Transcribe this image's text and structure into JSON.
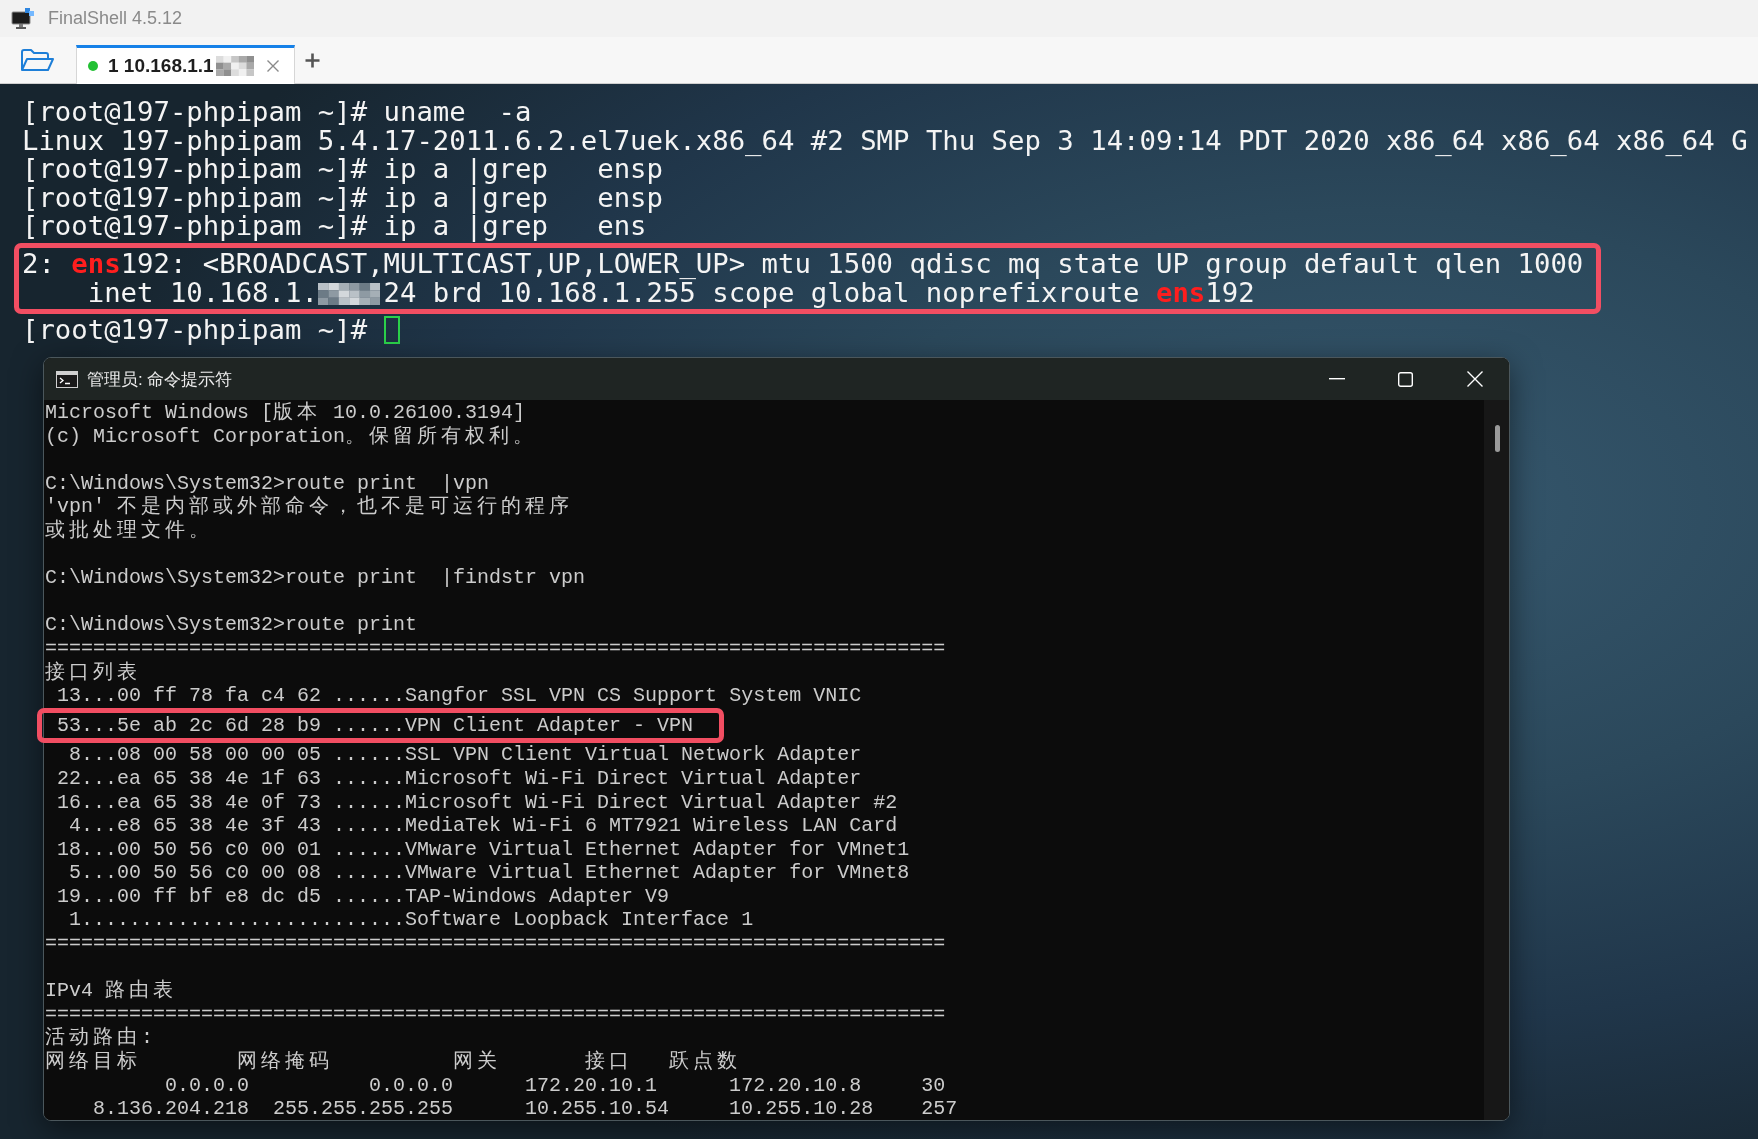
{
  "window": {
    "title": "FinalShell 4.5.12"
  },
  "tabs": [
    {
      "label": "1 10.168.1.1",
      "selected": true,
      "connected": true,
      "redacted": true
    }
  ],
  "terminal": {
    "lines": [
      {
        "text": "[root@197-phpipam ~]# uname  -a",
        "highlighted": false
      },
      {
        "text": "Linux 197-phpipam 5.4.17-2011.6.2.el7uek.x86_64 #2 SMP Thu Sep 3 14:09:14 PDT 2020 x86_64 x86_64 x86_64 G",
        "highlighted": false
      },
      {
        "text": "[root@197-phpipam ~]# ip a |grep   ensp",
        "highlighted": false
      },
      {
        "text": "[root@197-phpipam ~]# ip a |grep   ensp",
        "highlighted": false
      },
      {
        "text": "[root@197-phpipam ~]# ip a |grep   ens",
        "highlighted": false
      },
      {
        "text": "2: **ens**192: <BROADCAST,MULTICAST,UP,LOWER_UP> mtu 1500 qdisc mq state UP group default qlen 1000",
        "highlighted": true
      },
      {
        "parts": [
          {
            "kind": "text",
            "text": "    inet 10.168.1."
          },
          {
            "kind": "redacted"
          },
          {
            "kind": "text",
            "text": "24 brd 10.168.1.255 scope global noprefixroute **ens**192"
          }
        ],
        "highlighted": true
      },
      {
        "parts": [
          {
            "kind": "text",
            "text": "[root@197-phpipam ~]# "
          },
          {
            "kind": "cursor"
          }
        ],
        "highlighted": false
      }
    ]
  },
  "console_window": {
    "title": "管理员: 命令提示符",
    "blocks": [
      {
        "lines": [
          {
            "text": "Microsoft Windows [版本 10.0.26100.3194]",
            "highlighted": false
          },
          {
            "text": "(c) Microsoft Corporation。保留所有权利。",
            "highlighted": false
          }
        ]
      },
      {
        "lines": [
          {
            "text": "C:\\Windows\\System32>route print  |vpn",
            "highlighted": false
          },
          {
            "text": "'vpn' 不是内部或外部命令，也不是可运行的程序",
            "highlighted": false
          },
          {
            "text": "或批处理文件。",
            "highlighted": false
          }
        ]
      },
      {
        "lines": [
          {
            "text": "C:\\Windows\\System32>route print  |findstr vpn",
            "highlighted": false
          }
        ]
      },
      {
        "lines": [
          {
            "text": "C:\\Windows\\System32>route print",
            "highlighted": false
          },
          {
            "text": "===========================================================================",
            "highlighted": false
          },
          {
            "text": "接口列表",
            "highlighted": false
          },
          {
            "text": " 13...00 ff 78 fa c4 62 ......Sangfor SSL VPN CS Support System VNIC",
            "highlighted": false
          },
          {
            "text": " 53...5e ab 2c 6d 28 b9 ......VPN Client Adapter - VPN",
            "highlighted": true
          },
          {
            "text": "  8...08 00 58 00 00 05 ......SSL VPN Client Virtual Network Adapter",
            "highlighted": false
          },
          {
            "text": " 22...ea 65 38 4e 1f 63 ......Microsoft Wi-Fi Direct Virtual Adapter",
            "highlighted": false
          },
          {
            "text": " 16...ea 65 38 4e 0f 73 ......Microsoft Wi-Fi Direct Virtual Adapter #2",
            "highlighted": false
          },
          {
            "text": "  4...e8 65 38 4e 3f 43 ......MediaTek Wi-Fi 6 MT7921 Wireless LAN Card",
            "highlighted": false
          },
          {
            "text": " 18...00 50 56 c0 00 01 ......VMware Virtual Ethernet Adapter for VMnet1",
            "highlighted": false
          },
          {
            "text": "  5...00 50 56 c0 00 08 ......VMware Virtual Ethernet Adapter for VMnet8",
            "highlighted": false
          },
          {
            "text": " 19...00 ff bf e8 dc d5 ......TAP-Windows Adapter V9",
            "highlighted": false
          },
          {
            "text": "  1...........................Software Loopback Interface 1",
            "highlighted": false
          },
          {
            "text": "===========================================================================",
            "highlighted": false
          }
        ]
      },
      {
        "lines": [
          {
            "text": "IPv4 路由表",
            "highlighted": false
          },
          {
            "text": "===========================================================================",
            "highlighted": false
          },
          {
            "text": "活动路由:",
            "highlighted": false
          },
          {
            "cells": [
              "网络目标",
              "网络掩码",
              "网关",
              "接口",
              "跃点数"
            ],
            "highlighted": false
          },
          {
            "text": "          0.0.0.0          0.0.0.0      172.20.10.1      172.20.10.8     30",
            "highlighted": false
          },
          {
            "text": "    8.136.204.218  255.255.255.255      10.255.10.54     10.255.10.28    257",
            "highlighted": false
          }
        ]
      }
    ]
  }
}
